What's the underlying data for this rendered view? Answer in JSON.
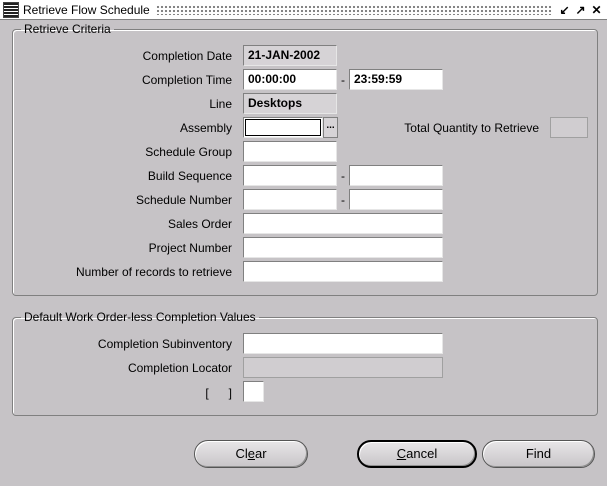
{
  "window": {
    "title": "Retrieve Flow Schedule"
  },
  "retrieve_criteria": {
    "legend": "Retrieve Criteria",
    "completion_date": {
      "label": "Completion Date",
      "value": "21-JAN-2002"
    },
    "completion_time": {
      "label": "Completion Time",
      "from": "00:00:00",
      "to": "23:59:59"
    },
    "line": {
      "label": "Line",
      "value": "Desktops"
    },
    "assembly": {
      "label": "Assembly",
      "value": ""
    },
    "total_quantity": {
      "label": "Total Quantity to Retrieve",
      "value": ""
    },
    "schedule_group": {
      "label": "Schedule Group",
      "value": ""
    },
    "build_sequence": {
      "label": "Build Sequence",
      "from": "",
      "to": ""
    },
    "schedule_number": {
      "label": "Schedule Number",
      "from": "",
      "to": ""
    },
    "sales_order": {
      "label": "Sales Order",
      "value": ""
    },
    "project_number": {
      "label": "Project Number",
      "value": ""
    },
    "num_records": {
      "label": "Number of records to retrieve",
      "value": ""
    },
    "range_separator": "-",
    "lov_glyph": "..."
  },
  "defaults": {
    "legend": "Default Work Order-less Completion Values",
    "completion_subinventory": {
      "label": "Completion Subinventory",
      "value": ""
    },
    "completion_locator": {
      "label": "Completion Locator",
      "value": ""
    },
    "checkbox_label": "[      ]"
  },
  "buttons": {
    "clear": {
      "pre": "Cl",
      "mnemonic": "e",
      "post": "ar"
    },
    "cancel": {
      "pre": "",
      "mnemonic": "C",
      "post": "ancel"
    },
    "find": {
      "label": "Find"
    }
  }
}
